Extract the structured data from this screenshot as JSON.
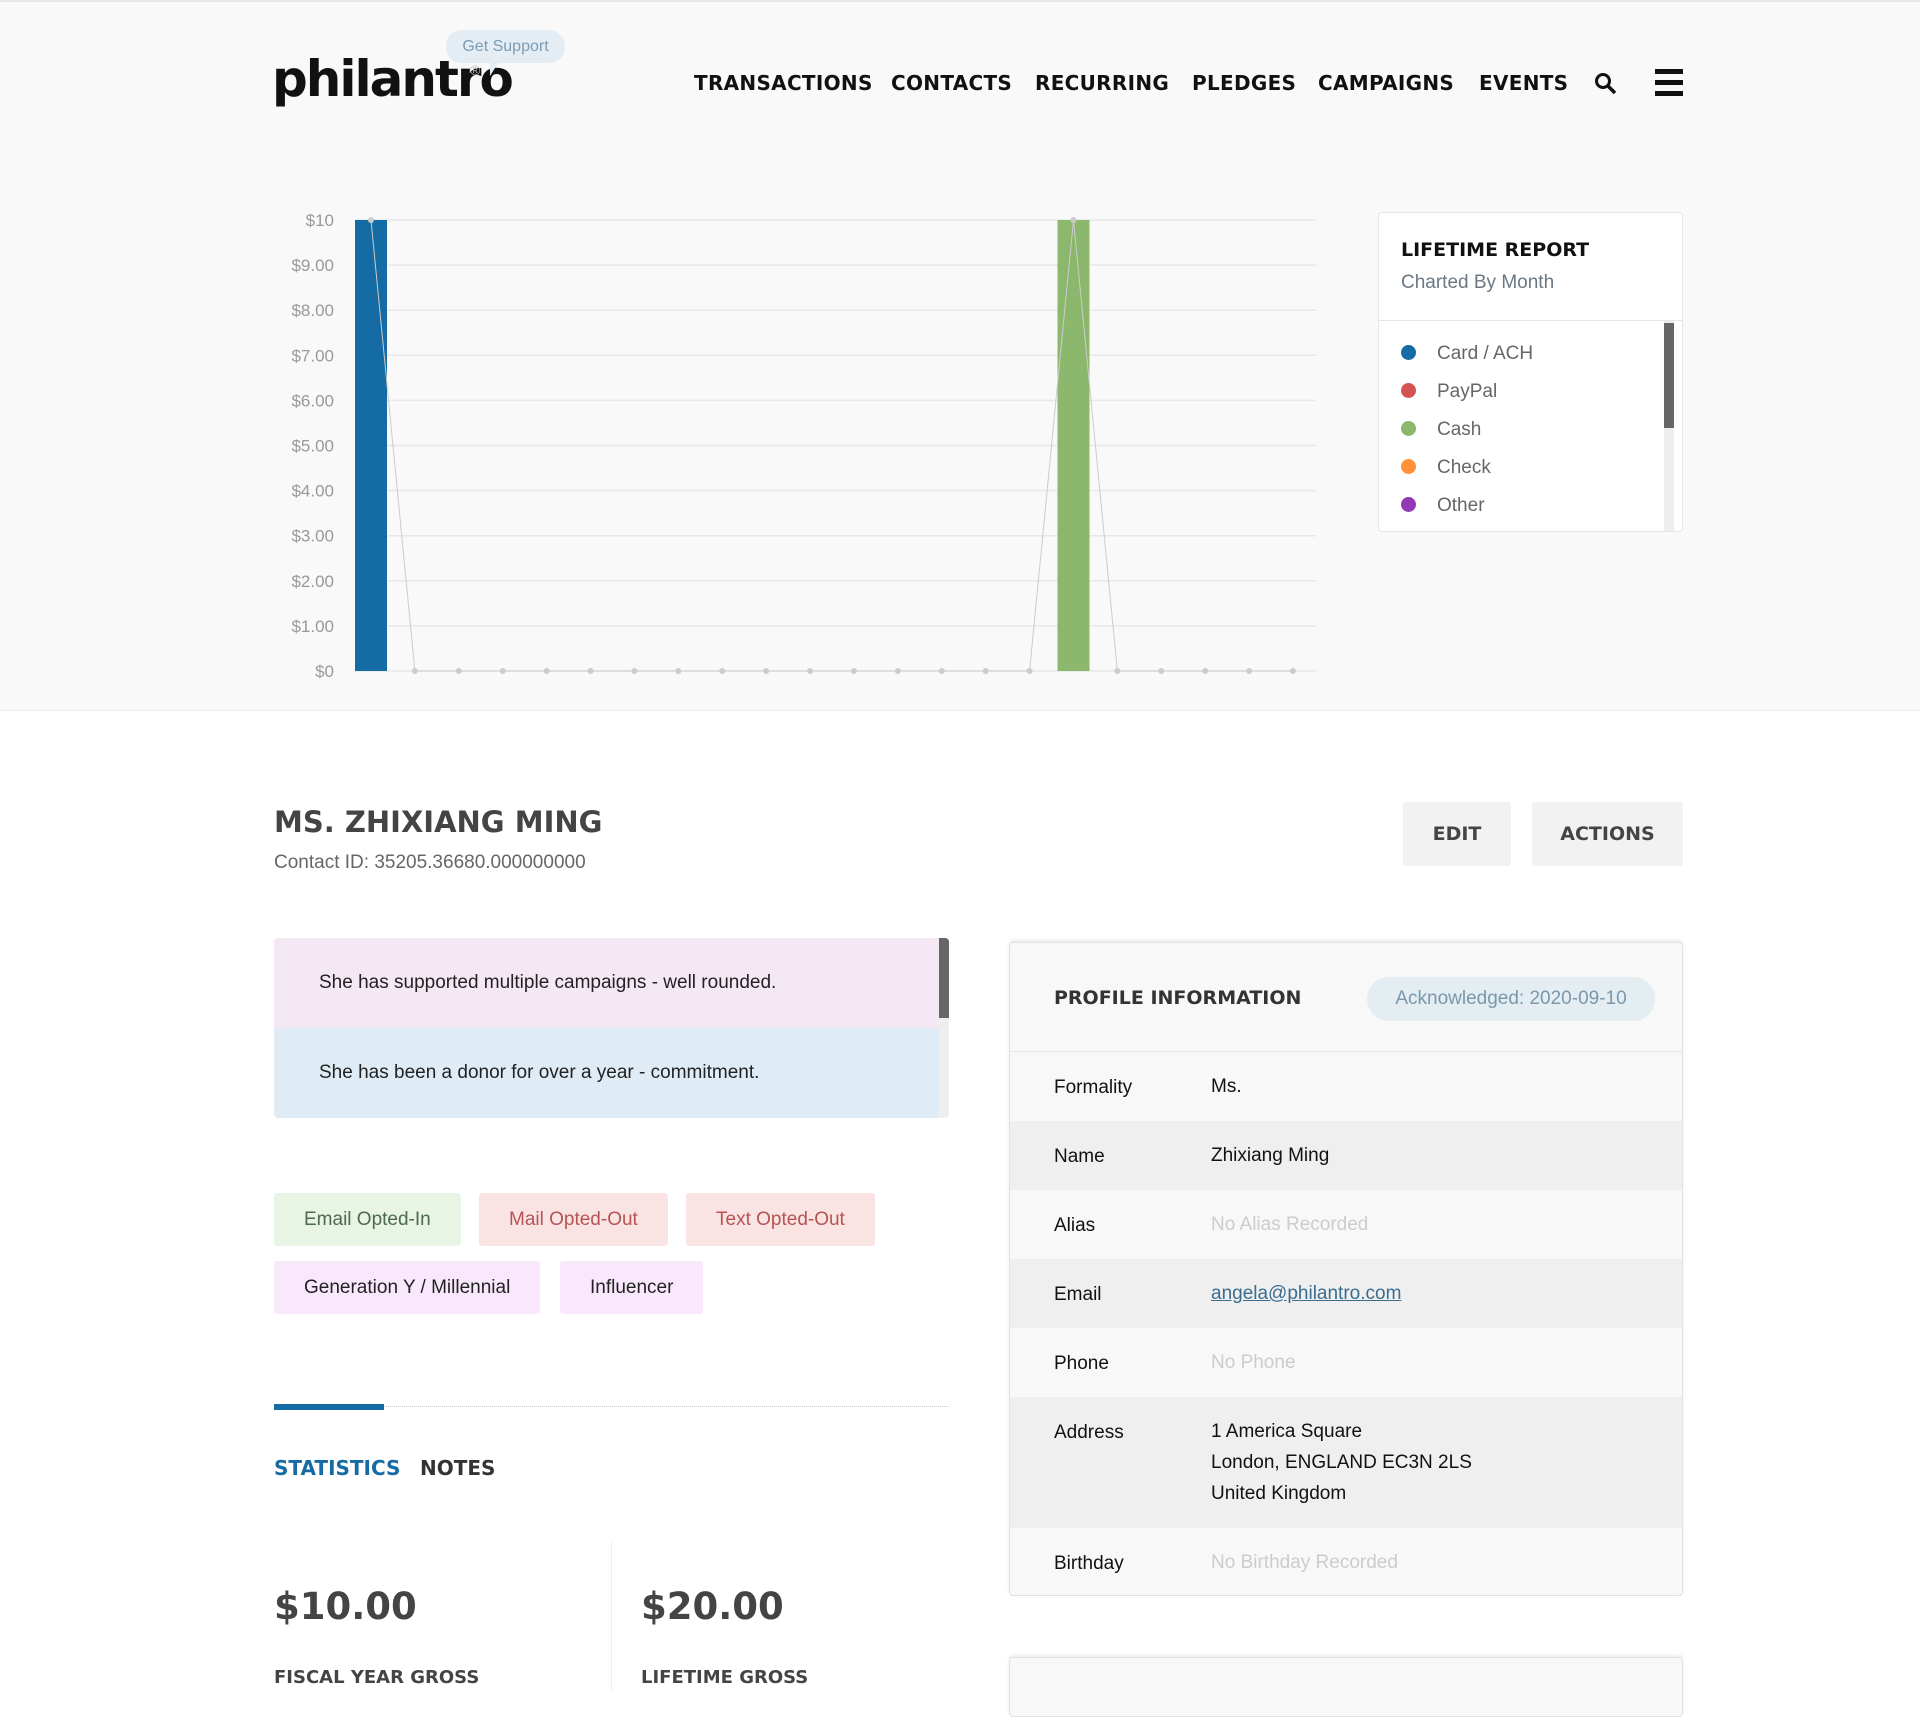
{
  "header": {
    "logo": "philantro",
    "support_label": "Get Support",
    "nav": [
      "TRANSACTIONS",
      "CONTACTS",
      "RECURRING",
      "PLEDGES",
      "CAMPAIGNS",
      "EVENTS"
    ],
    "search_icon": "search-icon",
    "menu_icon": "hamburger-menu-icon"
  },
  "chart_data": {
    "type": "bar",
    "y_ticks": [
      "$0",
      "$1.00",
      "$2.00",
      "$3.00",
      "$4.00",
      "$5.00",
      "$6.00",
      "$7.00",
      "$8.00",
      "$9.00",
      "$10"
    ],
    "ylim": [
      0,
      10
    ],
    "grid": true,
    "point_count": 22,
    "series": [
      {
        "name": "Card / ACH",
        "color": "#156ba3",
        "values": [
          10,
          0,
          0,
          0,
          0,
          0,
          0,
          0,
          0,
          0,
          0,
          0,
          0,
          0,
          0,
          0,
          0,
          0,
          0,
          0,
          0,
          0
        ]
      },
      {
        "name": "Cash",
        "color": "#8bb86c",
        "values": [
          0,
          0,
          0,
          0,
          0,
          0,
          0,
          0,
          0,
          0,
          0,
          0,
          0,
          0,
          0,
          0,
          10,
          0,
          0,
          0,
          0,
          0
        ]
      }
    ],
    "total_line": [
      10,
      0,
      0,
      0,
      0,
      0,
      0,
      0,
      0,
      0,
      0,
      0,
      0,
      0,
      0,
      0,
      10,
      0,
      0,
      0,
      0,
      0
    ]
  },
  "legend": {
    "title": "LIFETIME REPORT",
    "subtitle": "Charted By Month",
    "items": [
      {
        "label": "Card / ACH",
        "color": "#156ba3"
      },
      {
        "label": "PayPal",
        "color": "#d65353"
      },
      {
        "label": "Cash",
        "color": "#8bb86c"
      },
      {
        "label": "Check",
        "color": "#ff9138"
      },
      {
        "label": "Other",
        "color": "#9339b5"
      }
    ]
  },
  "contact": {
    "name": "MS. ZHIXIANG MING",
    "contact_id": "Contact ID: 35205.36680.000000000",
    "edit_label": "EDIT",
    "actions_label": "ACTIONS"
  },
  "notes": [
    "She has supported multiple campaigns - well rounded.",
    "She has been a donor for over a year - commitment."
  ],
  "tags": [
    {
      "label": "Email Opted-In",
      "bg": "#e8f4e4",
      "color": "#4c6b48"
    },
    {
      "label": "Mail Opted-Out",
      "bg": "#fae3e3",
      "color": "#b65454"
    },
    {
      "label": "Text Opted-Out",
      "bg": "#fae3e3",
      "color": "#b65454"
    },
    {
      "label": "Generation Y / Millennial",
      "bg": "#f9e8fb",
      "color": "#222"
    },
    {
      "label": "Influencer",
      "bg": "#f9e8fb",
      "color": "#222"
    }
  ],
  "tabs": [
    {
      "label": "STATISTICS",
      "active": true
    },
    {
      "label": "NOTES",
      "active": false
    }
  ],
  "stats": [
    {
      "amount": "$10.00",
      "label": "FISCAL YEAR GROSS"
    },
    {
      "amount": "$20.00",
      "label": "LIFETIME GROSS"
    }
  ],
  "profile": {
    "title": "PROFILE INFORMATION",
    "acknowledged": "Acknowledged: 2020-09-10",
    "rows": [
      {
        "label": "Formality",
        "value": "Ms."
      },
      {
        "label": "Name",
        "value": "Zhixiang Ming"
      },
      {
        "label": "Alias",
        "value": "No Alias Recorded"
      },
      {
        "label": "Email",
        "value": "angela@philantro.com"
      },
      {
        "label": "Phone",
        "value": "No Phone"
      },
      {
        "label": "Address",
        "value": [
          "1 America Square",
          "London, ENGLAND EC3N 2LS",
          "United Kingdom"
        ]
      },
      {
        "label": "Birthday",
        "value": "No Birthday Recorded"
      }
    ]
  }
}
